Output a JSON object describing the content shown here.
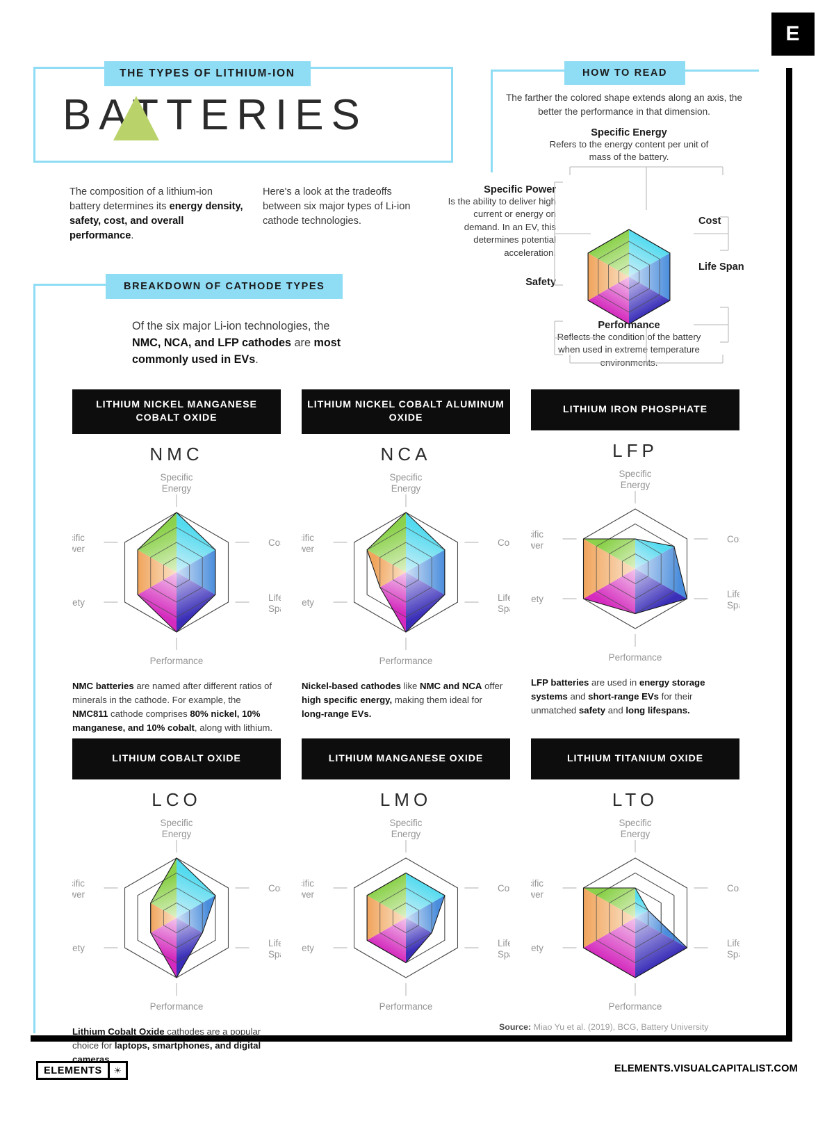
{
  "brand": {
    "logo_letter": "E",
    "footer_name": "ELEMENTS",
    "footer_icon": "globe-icon",
    "footer_url": "ELEMENTS.VISUALCAPITALIST.COM"
  },
  "header": {
    "eyebrow": "THE TYPES OF LITHIUM-ION",
    "title": "BATTERIES",
    "intro_left": "The composition of a lithium-ion battery determines its <b>energy density, safety, cost, and overall performance</b>.",
    "intro_right": "Here's a look at the tradeoffs between six major types of Li-ion cathode technologies."
  },
  "how_to_read": {
    "tag": "HOW TO READ",
    "subtitle": "The farther the colored shape extends along an axis, the better the performance in that dimension.",
    "axes": [
      {
        "name": "Specific Energy",
        "desc": "Refers to the energy content per unit of mass of the battery."
      },
      {
        "name": "Specific Power",
        "desc": "Is the ability to deliver high current or energy on demand. In an EV, this determines potential acceleration."
      },
      {
        "name": "Safety",
        "desc": ""
      },
      {
        "name": "Cost",
        "desc": ""
      },
      {
        "name": "Life Span",
        "desc": ""
      },
      {
        "name": "Performance",
        "desc": "Reflects the condition of the battery when used in extreme temperature environments."
      }
    ]
  },
  "breakdown": {
    "tag": "BREAKDOWN OF CATHODE TYPES",
    "subtitle": "Of the six major Li-ion technologies, the <b>NMC, NCA, and LFP cathodes</b> are <b>most commonly used in EVs</b>."
  },
  "chart_data": {
    "type": "radar",
    "axes": [
      "Specific Energy",
      "Cost",
      "Life Span",
      "Performance",
      "Safety",
      "Specific Power"
    ],
    "rings": 4,
    "rmax": 4,
    "axis_colors": {
      "Specific Energy": "#40d8ef",
      "Cost": "#3c7fd8",
      "Life Span": "#3c2fb5",
      "Performance": "#d42bbe",
      "Safety": "#f0a45c",
      "Specific Power": "#8bd14c"
    },
    "series": [
      {
        "name": "NMC",
        "values": [
          4,
          3,
          3,
          4,
          3,
          3
        ]
      },
      {
        "name": "NCA",
        "values": [
          4,
          3,
          3,
          4,
          2,
          3
        ]
      },
      {
        "name": "LFP",
        "values": [
          2,
          3,
          4,
          3,
          4,
          4
        ]
      },
      {
        "name": "LCO",
        "values": [
          4,
          3,
          2,
          4,
          2,
          2
        ]
      },
      {
        "name": "LMO",
        "values": [
          3,
          3,
          2,
          3,
          3,
          3
        ]
      },
      {
        "name": "LTO",
        "values": [
          2,
          1,
          4,
          4,
          4,
          4
        ]
      }
    ]
  },
  "cards": [
    {
      "title": "LITHIUM NICKEL MANGANESE COBALT OXIDE",
      "abbr": "NMC",
      "series": "NMC",
      "desc": "<b>NMC batteries</b> are named after different ratios of minerals in the cathode. For example, the <b>NMC811</b> cathode comprises <b>80% nickel, 10% manganese, and 10% cobalt</b>, along with lithium."
    },
    {
      "title": "LITHIUM NICKEL COBALT ALUMINUM OXIDE",
      "abbr": "NCA",
      "series": "NCA",
      "desc": "<b>Nickel-based cathodes</b> like <b>NMC and NCA</b> offer <b>high specific energy,</b> making them ideal for <b>long-range EVs.</b>"
    },
    {
      "title": "LITHIUM IRON PHOSPHATE",
      "abbr": "LFP",
      "series": "LFP",
      "desc": "<b>LFP batteries</b> are used in <b>energy storage systems</b> and <b>short-range EVs</b> for their unmatched <b>safety</b> and <b>long lifespans.</b>"
    },
    {
      "title": "LITHIUM COBALT OXIDE",
      "abbr": "LCO",
      "series": "LCO",
      "desc": "<b>Lithium Cobalt Oxide</b> cathodes are a popular choice for <b>laptops, smartphones, and digital cameras.</b>"
    },
    {
      "title": "LITHIUM MANGANESE OXIDE",
      "abbr": "LMO",
      "series": "LMO",
      "desc": ""
    },
    {
      "title": "LITHIUM TITANIUM OXIDE",
      "abbr": "LTO",
      "series": "LTO",
      "desc": ""
    }
  ],
  "source": {
    "label": "Source:",
    "text": "Miao Yu et al. (2019), BCG, Battery University"
  }
}
